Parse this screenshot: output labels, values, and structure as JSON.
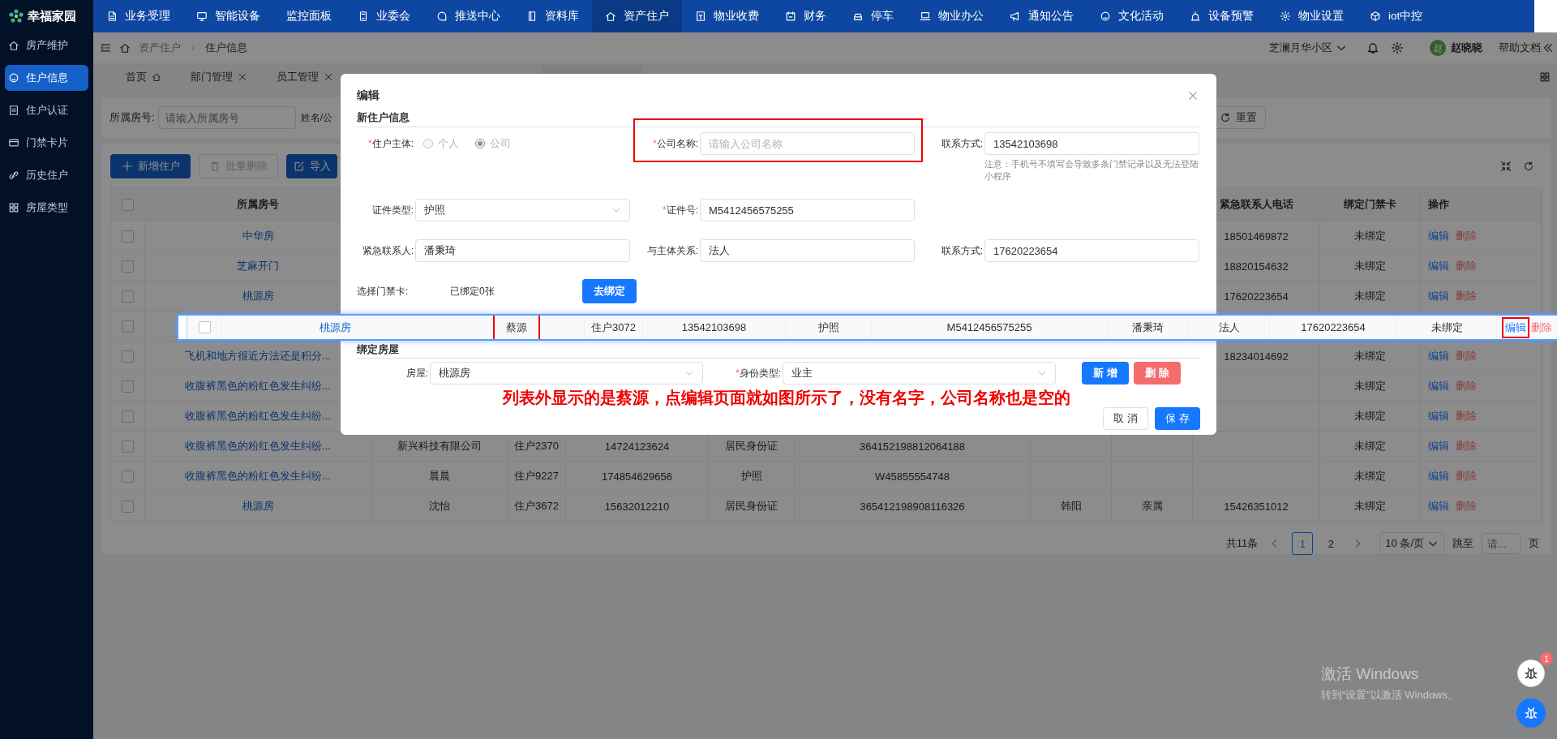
{
  "app": {
    "logo": "幸福家园"
  },
  "top_nav": [
    {
      "label": "业务受理",
      "selected": false
    },
    {
      "label": "智能设备",
      "selected": false
    },
    {
      "label": "监控面板",
      "selected": false
    },
    {
      "label": "业委会",
      "selected": false
    },
    {
      "label": "推送中心",
      "selected": false
    },
    {
      "label": "资料库",
      "selected": false
    },
    {
      "label": "资产住户",
      "selected": true
    },
    {
      "label": "物业收费",
      "selected": false
    },
    {
      "label": "财务",
      "selected": false
    },
    {
      "label": "停车",
      "selected": false
    },
    {
      "label": "物业办公",
      "selected": false
    },
    {
      "label": "通知公告",
      "selected": false
    },
    {
      "label": "文化活动",
      "selected": false
    },
    {
      "label": "设备预警",
      "selected": false
    },
    {
      "label": "物业设置",
      "selected": false
    },
    {
      "label": "iot中控",
      "selected": false
    }
  ],
  "sidebar": [
    {
      "label": "房产维护",
      "selected": false
    },
    {
      "label": "住户信息",
      "selected": true
    },
    {
      "label": "住户认证",
      "selected": false
    },
    {
      "label": "门禁卡片",
      "selected": false
    },
    {
      "label": "历史住户",
      "selected": false
    },
    {
      "label": "房屋类型",
      "selected": false
    }
  ],
  "breadcrumb": [
    "资产住户",
    "住户信息"
  ],
  "header": {
    "community": "芝澜月华小区",
    "avatar": "赵",
    "user": "赵晓晓",
    "help": "帮助文档"
  },
  "tabs": [
    {
      "kind": "home",
      "label": "首页"
    },
    {
      "kind": "closable",
      "label": "部门管理"
    },
    {
      "kind": "closable",
      "label": "员工管理"
    },
    {
      "kind": "covered"
    }
  ],
  "filters": [
    {
      "label": "所属房号:",
      "placeholder": "请输入所属房号"
    },
    {
      "label": "姓名/公"
    }
  ],
  "reset_button": "重置",
  "toolbar": [
    {
      "label": "新增住户",
      "kind": "primary"
    },
    {
      "label": "批量删除",
      "kind": "disabled"
    },
    {
      "label": "导入",
      "kind": "primary"
    }
  ],
  "table": {
    "all_checked": false,
    "columns": {
      "room": "所属房号",
      "emergency_phone": "紧急联系人电话",
      "card": "绑定门禁卡",
      "actions": "操作"
    },
    "rows": [
      {
        "checked": false,
        "room": "中华房",
        "emergency_phone": "18501469872",
        "card": "未绑定",
        "actions": [
          {
            "label": "编辑",
            "kind": "edit"
          },
          {
            "label": "删除",
            "kind": "delete"
          }
        ]
      },
      {
        "checked": false,
        "room": "芝麻开门",
        "emergency_phone": "18820154632",
        "card": "未绑定",
        "actions": [
          {
            "label": "编辑",
            "kind": "edit"
          },
          {
            "label": "删除",
            "kind": "delete"
          }
        ]
      },
      {
        "checked": false,
        "room": "桃源房",
        "emergency_phone": "17620223654",
        "card": "未绑定",
        "actions": [
          {
            "label": "编辑",
            "kind": "edit"
          },
          {
            "label": "删除",
            "kind": "delete"
          }
        ]
      },
      {
        "checked": false
      },
      {
        "checked": false,
        "room": "飞机和地方很近方法还是积分...",
        "emergency_phone": "18234014692",
        "card": "未绑定",
        "actions": [
          {
            "label": "编辑",
            "kind": "edit"
          },
          {
            "label": "删除",
            "kind": "delete"
          }
        ]
      },
      {
        "checked": false,
        "room": "收腹裤黑色的粉红色发生纠纷...",
        "card": "未绑定",
        "actions": [
          {
            "label": "编辑",
            "kind": "edit"
          },
          {
            "label": "删除",
            "kind": "delete"
          }
        ]
      },
      {
        "checked": false,
        "room": "收腹裤黑色的粉红色发生纠纷...",
        "card": "未绑定",
        "actions": [
          {
            "label": "编辑",
            "kind": "edit"
          },
          {
            "label": "删除",
            "kind": "delete"
          }
        ]
      },
      {
        "checked": false,
        "room": "收腹裤黑色的粉红色发生纠纷...",
        "name": "新兴科技有限公司",
        "resident_no": "住户2370",
        "phone": "14724123624",
        "id_type": "居民身份证",
        "id_no": "364152198812064188",
        "card": "未绑定",
        "actions": [
          {
            "label": "编辑",
            "kind": "edit"
          },
          {
            "label": "删除",
            "kind": "delete"
          }
        ]
      },
      {
        "checked": false,
        "room": "收腹裤黑色的粉红色发生纠纷...",
        "name": "晨晨",
        "resident_no": "住户9227",
        "phone": "174854629656",
        "id_type": "护照",
        "id_no": "W45855554748",
        "card": "未绑定",
        "actions": [
          {
            "label": "编辑",
            "kind": "edit"
          },
          {
            "label": "删除",
            "kind": "delete"
          }
        ]
      },
      {
        "checked": false,
        "room": "桃源房",
        "name": "沈怡",
        "resident_no": "住户3672",
        "phone": "15632012210",
        "id_type": "居民身份证",
        "id_no": "365412198908116326",
        "contact": "韩阳",
        "relation": "亲属",
        "emergency_phone": "15426351012",
        "card": "未绑定",
        "actions": [
          {
            "label": "编辑",
            "kind": "edit"
          },
          {
            "label": "删除",
            "kind": "delete"
          }
        ]
      }
    ]
  },
  "dragged_row": {
    "checked": false,
    "room": "桃源房",
    "name": "蔡源",
    "name_highlighted": true,
    "resident_no": "住户3072",
    "phone": "13542103698",
    "id_type": "护照",
    "id_no": "M5412456575255",
    "contact": "潘秉琦",
    "relation": "法人",
    "emergency_phone": "17620223654",
    "card": "未绑定",
    "actions": [
      {
        "label": "编辑",
        "kind": "edit",
        "highlighted": true
      },
      {
        "label": "删除",
        "kind": "delete",
        "highlighted": false
      }
    ]
  },
  "pagination": {
    "total": "共11条",
    "pages": [
      {
        "label": "1",
        "selected": true
      },
      {
        "label": "2",
        "selected": false
      }
    ],
    "page_size": "10 条/页",
    "jump_label": "跳至",
    "jump_placeholder": "请...",
    "page_suffix": "页"
  },
  "modal": {
    "title": "编辑",
    "section_title": "新住户信息",
    "form_rows": [
      [
        {
          "kind": "radio",
          "mark": "*",
          "label": "住户主体:",
          "disabled": true,
          "options": [
            {
              "label": "个人",
              "selected": false
            },
            {
              "label": "公司",
              "selected": true
            }
          ]
        },
        {
          "kind": "input",
          "mark": "*",
          "label": "公司名称:",
          "placeholder": "请输入公司名称",
          "highlighted": true
        },
        {
          "kind": "input",
          "label": "联系方式:",
          "value": "13542103698",
          "note": "注意：手机号不填写会导致多条门禁记录以及无法登陆小程序"
        }
      ],
      [
        {
          "kind": "select",
          "label": "证件类型:",
          "value": "护照"
        },
        {
          "kind": "input",
          "mark": "*",
          "label": "证件号:",
          "value": "M5412456575255"
        }
      ],
      [
        {
          "kind": "input",
          "label": "紧急联系人:",
          "value": "潘秉琦"
        },
        {
          "kind": "input",
          "label": "与主体关系:",
          "value": "法人"
        },
        {
          "kind": "input",
          "label": "联系方式:",
          "value": "17620223654"
        }
      ]
    ],
    "card": {
      "label": "选择门禁卡:",
      "status": "已绑定0张",
      "button": "去绑定"
    },
    "house_section_title": "绑定房屋",
    "house": [
      {
        "label": "房屋:",
        "value": "桃源房"
      },
      {
        "mark": "*",
        "label": "身份类型:",
        "value": "业主"
      }
    ],
    "house_buttons": [
      {
        "label": "新 增",
        "kind": "primary"
      },
      {
        "label": "删 除",
        "kind": "danger"
      }
    ],
    "annotation": "列表外显示的是蔡源，点编辑页面就如图所示了，没有名字，公司名称也是空的",
    "footer_buttons": [
      {
        "label": "取 消",
        "kind": "default"
      },
      {
        "label": "保 存",
        "kind": "primary"
      }
    ]
  },
  "debug_badge": "1",
  "windows_activation": {
    "title": "激活 Windows",
    "hint": "转到“设置”以激活 Windows。"
  }
}
